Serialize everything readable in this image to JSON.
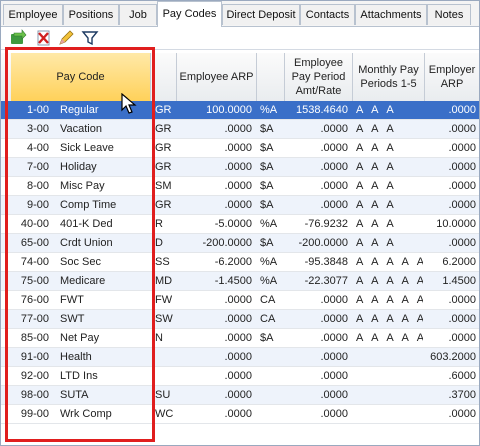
{
  "tabs": [
    {
      "label": "Employee",
      "active": false
    },
    {
      "label": "Positions",
      "active": false
    },
    {
      "label": "Job",
      "active": false
    },
    {
      "label": "Pay Codes",
      "active": true
    },
    {
      "label": "Direct Deposit",
      "active": false
    },
    {
      "label": "Contacts",
      "active": false
    },
    {
      "label": "Attachments",
      "active": false
    },
    {
      "label": "Notes",
      "active": false
    }
  ],
  "toolbar": {
    "icons": [
      "refresh-icon",
      "delete-icon",
      "edit-icon",
      "filter-icon"
    ]
  },
  "grid": {
    "headers": {
      "pay_code": "Pay Code",
      "employee_arp": "Employee ARP",
      "employee_pay_period": "Employee Pay Period Amt/Rate",
      "monthly_pay_periods": "Monthly Pay Periods 1-5",
      "employer_arp": "Employer ARP"
    },
    "rows": [
      {
        "num": "1-00",
        "name": "Regular",
        "short": "GR",
        "arp": "100.0000",
        "unit": "%A",
        "amt": "1538.4640",
        "mp": "A A A",
        "earp": ".0000"
      },
      {
        "num": "3-00",
        "name": "Vacation",
        "short": "GR",
        "arp": ".0000",
        "unit": "$A",
        "amt": ".0000",
        "mp": "A A A",
        "earp": ".0000"
      },
      {
        "num": "4-00",
        "name": "Sick Leave",
        "short": "GR",
        "arp": ".0000",
        "unit": "$A",
        "amt": ".0000",
        "mp": "A A A",
        "earp": ".0000"
      },
      {
        "num": "7-00",
        "name": "Holiday",
        "short": "GR",
        "arp": ".0000",
        "unit": "$A",
        "amt": ".0000",
        "mp": "A A A",
        "earp": ".0000"
      },
      {
        "num": "8-00",
        "name": "Misc Pay",
        "short": "SM",
        "arp": ".0000",
        "unit": "$A",
        "amt": ".0000",
        "mp": "A A A",
        "earp": ".0000"
      },
      {
        "num": "9-00",
        "name": "Comp Time",
        "short": "GR",
        "arp": ".0000",
        "unit": "$A",
        "amt": ".0000",
        "mp": "A A A",
        "earp": ".0000"
      },
      {
        "num": "40-00",
        "name": "401-K Ded",
        "short": "R",
        "arp": "-5.0000",
        "unit": "%A",
        "amt": "-76.9232",
        "mp": "A A A",
        "earp": "10.0000"
      },
      {
        "num": "65-00",
        "name": "Crdt Union",
        "short": "D",
        "arp": "-200.0000",
        "unit": "$A",
        "amt": "-200.0000",
        "mp": "A A A",
        "earp": ".0000"
      },
      {
        "num": "74-00",
        "name": "Soc Sec",
        "short": "SS",
        "arp": "-6.2000",
        "unit": "%A",
        "amt": "-95.3848",
        "mp": "A A A A A",
        "earp": "6.2000"
      },
      {
        "num": "75-00",
        "name": "Medicare",
        "short": "MD",
        "arp": "-1.4500",
        "unit": "%A",
        "amt": "-22.3077",
        "mp": "A A A A A",
        "earp": "1.4500"
      },
      {
        "num": "76-00",
        "name": "FWT",
        "short": "FW",
        "arp": ".0000",
        "unit": "CA",
        "amt": ".0000",
        "mp": "A A A A A",
        "earp": ".0000"
      },
      {
        "num": "77-00",
        "name": "SWT",
        "short": "SW",
        "arp": ".0000",
        "unit": "CA",
        "amt": ".0000",
        "mp": "A A A A A",
        "earp": ".0000"
      },
      {
        "num": "85-00",
        "name": "Net Pay",
        "short": "N",
        "arp": ".0000",
        "unit": "$A",
        "amt": ".0000",
        "mp": "A A A A A",
        "earp": ".0000"
      },
      {
        "num": "91-00",
        "name": "Health",
        "short": "",
        "arp": ".0000",
        "unit": "",
        "amt": ".0000",
        "mp": "",
        "earp": "603.2000"
      },
      {
        "num": "92-00",
        "name": "LTD Ins",
        "short": "",
        "arp": ".0000",
        "unit": "",
        "amt": ".0000",
        "mp": "",
        "earp": ".6000"
      },
      {
        "num": "98-00",
        "name": "SUTA",
        "short": "SU",
        "arp": ".0000",
        "unit": "",
        "amt": ".0000",
        "mp": "",
        "earp": ".3700"
      },
      {
        "num": "99-00",
        "name": "Wrk Comp",
        "short": "WC",
        "arp": ".0000",
        "unit": "",
        "amt": ".0000",
        "mp": "",
        "earp": ".0000"
      }
    ],
    "selected_row": 0
  },
  "colors": {
    "selected_row": "#3a6fc8",
    "header_highlight": "#ffd15a",
    "annotation": "#e01e1e"
  }
}
